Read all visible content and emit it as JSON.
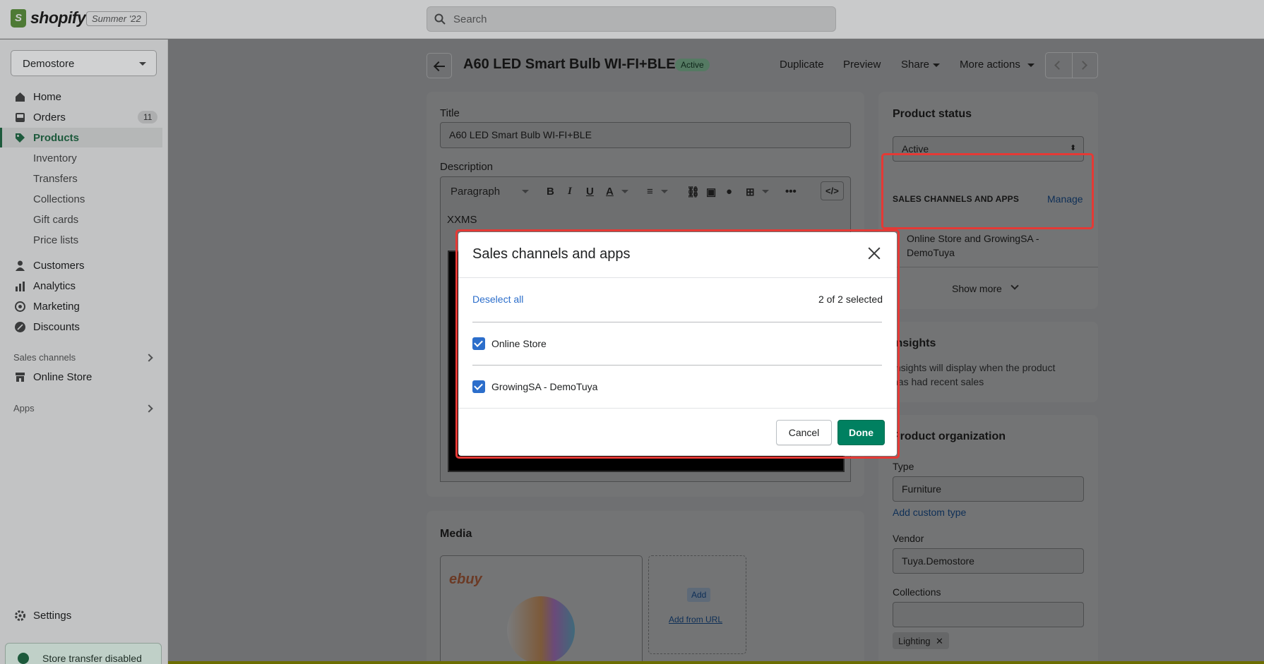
{
  "topbar": {
    "brand": "shopify",
    "season": "Summer '22",
    "search_placeholder": "Search"
  },
  "sidebar": {
    "store": "Demostore",
    "items": [
      {
        "label": "Home"
      },
      {
        "label": "Orders",
        "count": "11"
      },
      {
        "label": "Products"
      },
      {
        "label": "Inventory"
      },
      {
        "label": "Transfers"
      },
      {
        "label": "Collections"
      },
      {
        "label": "Gift cards"
      },
      {
        "label": "Price lists"
      },
      {
        "label": "Customers"
      },
      {
        "label": "Analytics"
      },
      {
        "label": "Marketing"
      },
      {
        "label": "Discounts"
      }
    ],
    "sales_channels_label": "Sales channels",
    "online_store": "Online Store",
    "apps_label": "Apps",
    "settings": "Settings",
    "toast": "Store transfer disabled"
  },
  "header": {
    "title": "A60 LED Smart Bulb WI-FI+BLE",
    "status": "Active",
    "actions": {
      "duplicate": "Duplicate",
      "preview": "Preview",
      "share": "Share",
      "more": "More actions"
    }
  },
  "product_form": {
    "title_label": "Title",
    "title_value": "A60 LED Smart Bulb WI-FI+BLE",
    "description_label": "Description",
    "paragraph": "Paragraph",
    "body_text": "XXMS",
    "media_label": "Media",
    "media_logo": "ebuy",
    "media_add": "Add",
    "media_add_url": "Add from URL"
  },
  "right": {
    "product_status": "Product status",
    "status_value": "Active",
    "channels_heading": "SALES CHANNELS AND APPS",
    "manage": "Manage",
    "channels_summary": "Online Store and GrowingSA - DemoTuya",
    "show_more": "Show more",
    "insights_title": "Insights",
    "insights_text": "Insights will display when the product has had recent sales",
    "org_title": "Product organization",
    "type_label": "Type",
    "type_value": "Furniture",
    "add_custom_type": "Add custom type",
    "vendor_label": "Vendor",
    "vendor_value": "Tuya.Demostore",
    "collections_label": "Collections",
    "tag": "Lighting"
  },
  "modal": {
    "title": "Sales channels and apps",
    "deselect_all": "Deselect all",
    "selected_count": "2 of 2 selected",
    "options": [
      {
        "label": "Online Store",
        "checked": true
      },
      {
        "label": "GrowingSA - DemoTuya",
        "checked": true
      }
    ],
    "cancel": "Cancel",
    "done": "Done"
  },
  "colors": {
    "primary": "#008060",
    "link": "#2c6ecb",
    "highlight": "#e53935"
  }
}
